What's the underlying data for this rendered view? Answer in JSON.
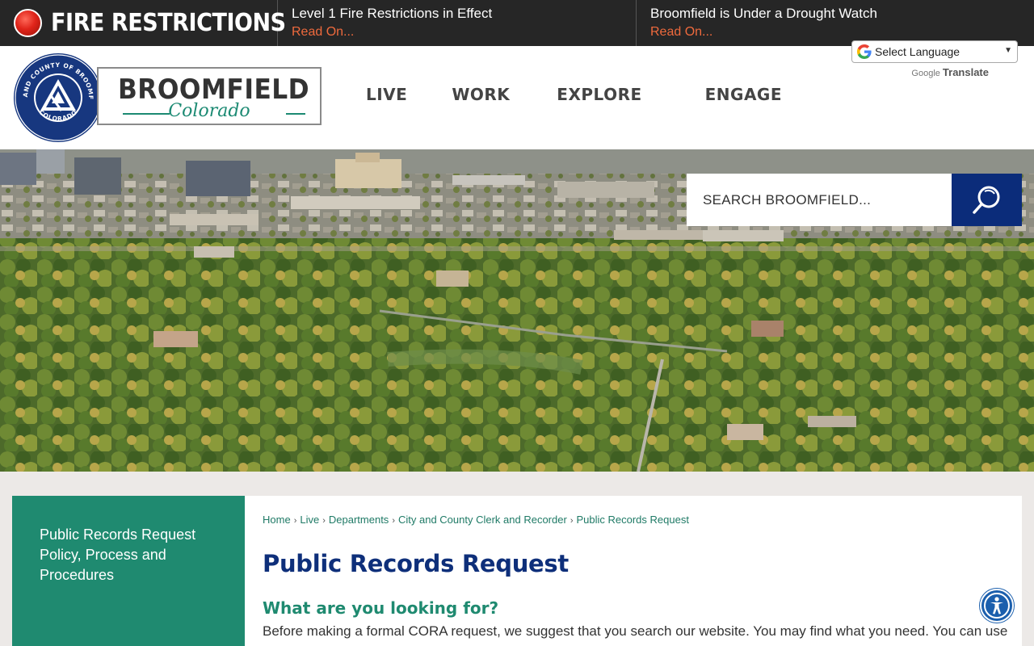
{
  "alert_bar": {
    "title": "FIRE RESTRICTIONS",
    "items": [
      {
        "title": "Level 1 Fire Restrictions in Effect",
        "link": "Read On..."
      },
      {
        "title": "Broomfield is Under a Drought Watch",
        "link": "Read On..."
      }
    ]
  },
  "header": {
    "logo": {
      "seal_text_top": "CITY AND COUNTY OF BROOMFIELD",
      "seal_text_bottom": "COLORADO",
      "wordmark": "BROOMFIELD",
      "subtitle": "Colorado"
    },
    "nav": [
      "LIVE",
      "WORK",
      "EXPLORE",
      "ENGAGE"
    ],
    "translate": {
      "select_label": "Select Language",
      "powered_by": "Google",
      "translate_label": "Translate"
    }
  },
  "search": {
    "placeholder": "SEARCH BROOMFIELD..."
  },
  "sidebar": {
    "link": "Public Records Request Policy, Process and Procedures"
  },
  "breadcrumb": [
    "Home",
    "Live",
    "Departments",
    "City and County Clerk and Recorder",
    "Public Records Request"
  ],
  "content": {
    "title": "Public Records Request",
    "heading": "What are you looking for?",
    "body": "Before making a formal CORA request, we suggest that you search our website. You may find what you need. You can use"
  },
  "colors": {
    "alert_bg": "#262626",
    "alert_link": "#ef6a3d",
    "brand_green": "#1f8a70",
    "brand_navy": "#0e2f7a",
    "search_button": "#0b2c7a"
  },
  "icons": {
    "alert": "red-alert-dot-icon",
    "search": "search-icon",
    "google": "google-g-icon",
    "accessibility": "accessibility-icon"
  }
}
